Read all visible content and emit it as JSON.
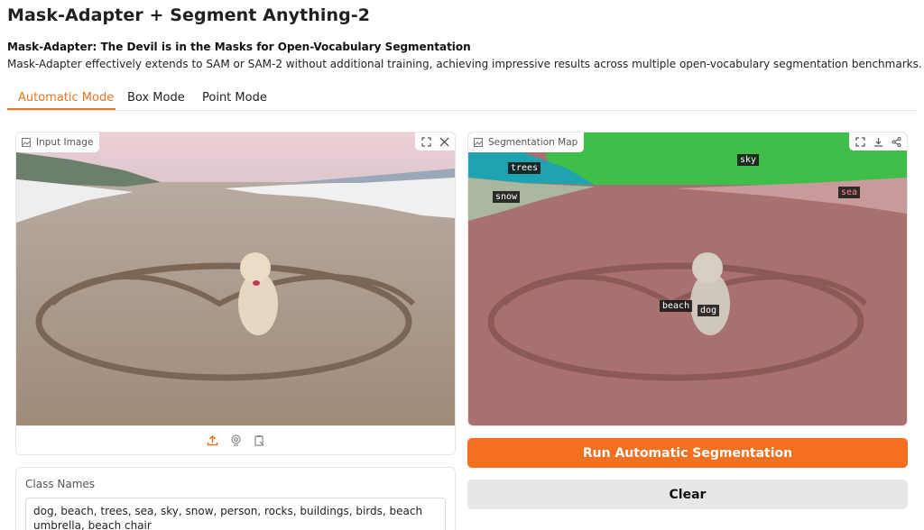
{
  "header": {
    "title": "Mask-Adapter + Segment Anything-2",
    "subtitle": "Mask-Adapter: The Devil is in the Masks for Open-Vocabulary Segmentation",
    "description": "Mask-Adapter effectively extends to SAM or SAM-2 without additional training, achieving impressive results across multiple open-vocabulary segmentation benchmarks."
  },
  "tabs": [
    {
      "label": "Automatic Mode",
      "active": true
    },
    {
      "label": "Box Mode",
      "active": false
    },
    {
      "label": "Point Mode",
      "active": false
    }
  ],
  "input_panel": {
    "label": "Input Image",
    "label_icon": "image-icon",
    "tools": [
      "fullscreen-icon",
      "close-icon"
    ],
    "upload_sources": [
      "upload-icon",
      "webcam-icon",
      "clipboard-icon"
    ]
  },
  "seg_panel": {
    "label": "Segmentation Map",
    "label_icon": "image-icon",
    "tools": [
      "fullscreen-icon",
      "download-icon",
      "share-icon"
    ],
    "tags": [
      "sky",
      "trees",
      "snow",
      "sea",
      "beach",
      "dog"
    ]
  },
  "buttons": {
    "run": "Run Automatic Segmentation",
    "clear": "Clear"
  },
  "class_names": {
    "label": "Class Names",
    "value": "dog, beach, trees, sea, sky, snow, person, rocks, buildings, birds, beach umbrella, beach chair"
  },
  "colors": {
    "accent": "#ea7420",
    "run_button": "#f46f1f",
    "clear_button": "#e7e7e7",
    "sky_mask": "#3fbf4a",
    "trees_mask": "#1fa3b0",
    "beach_mask": "#b77a78"
  }
}
